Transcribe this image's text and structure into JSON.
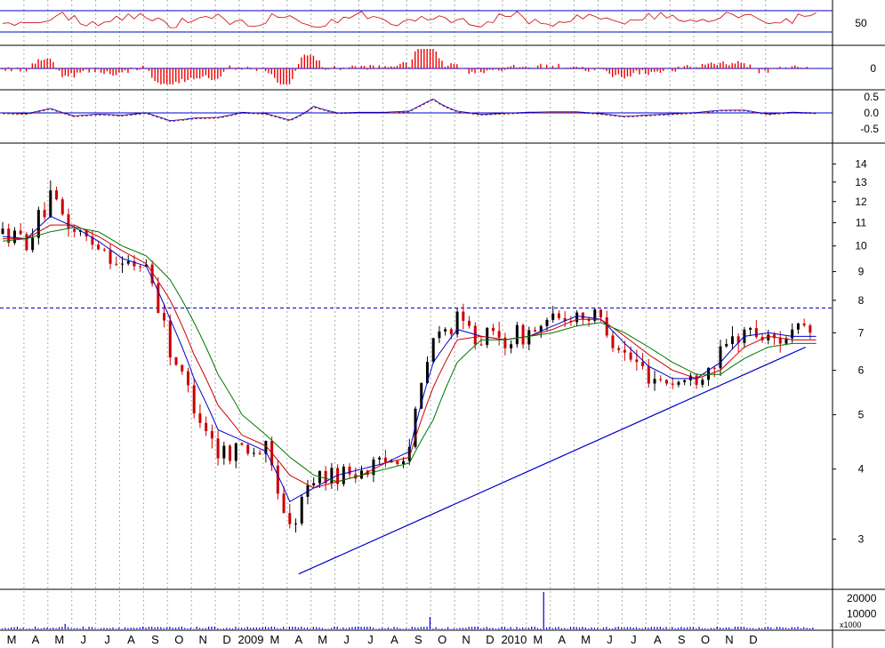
{
  "chart_data": {
    "type": "line",
    "subtype": "candlestick",
    "scale": "log",
    "grid": true,
    "price_axis_ticks": [
      "3",
      "4",
      "5",
      "6",
      "7",
      "8",
      "9",
      "10",
      "11",
      "12",
      "13",
      "14"
    ],
    "month_labels": [
      "M",
      "A",
      "M",
      "J",
      "J",
      "A",
      "S",
      "O",
      "N",
      "D",
      "2009",
      "M",
      "A",
      "M",
      "J",
      "J",
      "A",
      "S",
      "O",
      "N",
      "D",
      "2010",
      "M",
      "A",
      "M",
      "J",
      "J",
      "A",
      "S",
      "O",
      "N",
      "D"
    ],
    "indicator_panels": [
      {
        "name": "oscillator",
        "ticks": [
          "50"
        ],
        "reference": 50
      },
      {
        "name": "histogram",
        "ticks": [
          "0"
        ],
        "reference": 0
      },
      {
        "name": "momentum",
        "ticks": [
          "0.5",
          "0.0",
          "-0.5"
        ],
        "reference": 0.0
      }
    ],
    "volume_panel": {
      "ticks": [
        "20000",
        "10000"
      ],
      "unit_label": "x1000",
      "peak": 24000
    },
    "resistance_level": 7.75,
    "trendline": {
      "start": {
        "month": "2009-03",
        "price": 2.6
      },
      "end": {
        "month": "2010-12",
        "price": 6.6
      }
    },
    "series": [
      {
        "name": "price",
        "color": "#cc0000",
        "x": [
          "2008-03",
          "2008-04",
          "2008-05",
          "2008-06",
          "2008-07",
          "2008-08",
          "2008-09",
          "2008-10",
          "2008-11",
          "2008-12",
          "2009-01",
          "2009-02",
          "2009-03",
          "2009-04",
          "2009-05",
          "2009-06",
          "2009-07",
          "2009-08",
          "2009-09",
          "2009-10",
          "2009-11",
          "2009-12",
          "2010-01",
          "2010-02",
          "2010-03",
          "2010-04",
          "2010-05",
          "2010-06",
          "2010-07",
          "2010-08",
          "2010-09",
          "2010-10",
          "2010-11",
          "2010-12"
        ],
        "values": [
          10.5,
          10.2,
          12.0,
          10.6,
          10.1,
          9.2,
          9.3,
          6.5,
          5.2,
          4.3,
          4.4,
          4.3,
          3.1,
          3.9,
          3.9,
          4.0,
          4.1,
          4.4,
          6.8,
          7.3,
          6.9,
          6.8,
          7.0,
          7.3,
          7.6,
          7.4,
          6.4,
          5.9,
          5.7,
          5.8,
          6.4,
          7.1,
          6.8,
          7.0
        ]
      },
      {
        "name": "moving average short",
        "color": "#0000cc",
        "values": [
          10.4,
          10.3,
          11.3,
          10.8,
          10.2,
          9.5,
          9.2,
          7.4,
          5.8,
          4.7,
          4.5,
          4.3,
          3.5,
          3.7,
          3.9,
          4.0,
          4.1,
          4.3,
          6.2,
          7.1,
          6.9,
          6.8,
          6.9,
          7.2,
          7.5,
          7.4,
          6.7,
          6.1,
          5.8,
          5.8,
          6.2,
          6.9,
          7.0,
          6.9
        ]
      },
      {
        "name": "moving average medium",
        "color": "#cc0000",
        "values": [
          10.3,
          10.3,
          10.9,
          10.9,
          10.4,
          9.8,
          9.3,
          8.0,
          6.4,
          5.2,
          4.6,
          4.4,
          3.9,
          3.7,
          3.8,
          3.9,
          4.1,
          4.2,
          5.6,
          6.8,
          6.9,
          6.8,
          6.9,
          7.1,
          7.4,
          7.4,
          6.9,
          6.4,
          6.0,
          5.8,
          6.0,
          6.6,
          6.9,
          6.8
        ]
      },
      {
        "name": "moving average long",
        "color": "#007700",
        "values": [
          10.2,
          10.3,
          10.6,
          10.8,
          10.6,
          10.0,
          9.6,
          8.7,
          7.3,
          5.9,
          5.0,
          4.6,
          4.2,
          3.9,
          3.8,
          3.9,
          4.0,
          4.1,
          4.9,
          6.2,
          6.8,
          6.8,
          6.9,
          7.0,
          7.2,
          7.3,
          7.0,
          6.6,
          6.2,
          5.9,
          5.9,
          6.3,
          6.6,
          6.7
        ]
      }
    ]
  },
  "colors": {
    "up_candle": "#000000",
    "down_candle": "#cc0000",
    "trendline": "#0000cc",
    "resistance": "#0000cc",
    "grid": "#aaaaaa",
    "volume": "#0000cc",
    "oscillator": "#cc0000",
    "histogram": "#ee0000"
  }
}
